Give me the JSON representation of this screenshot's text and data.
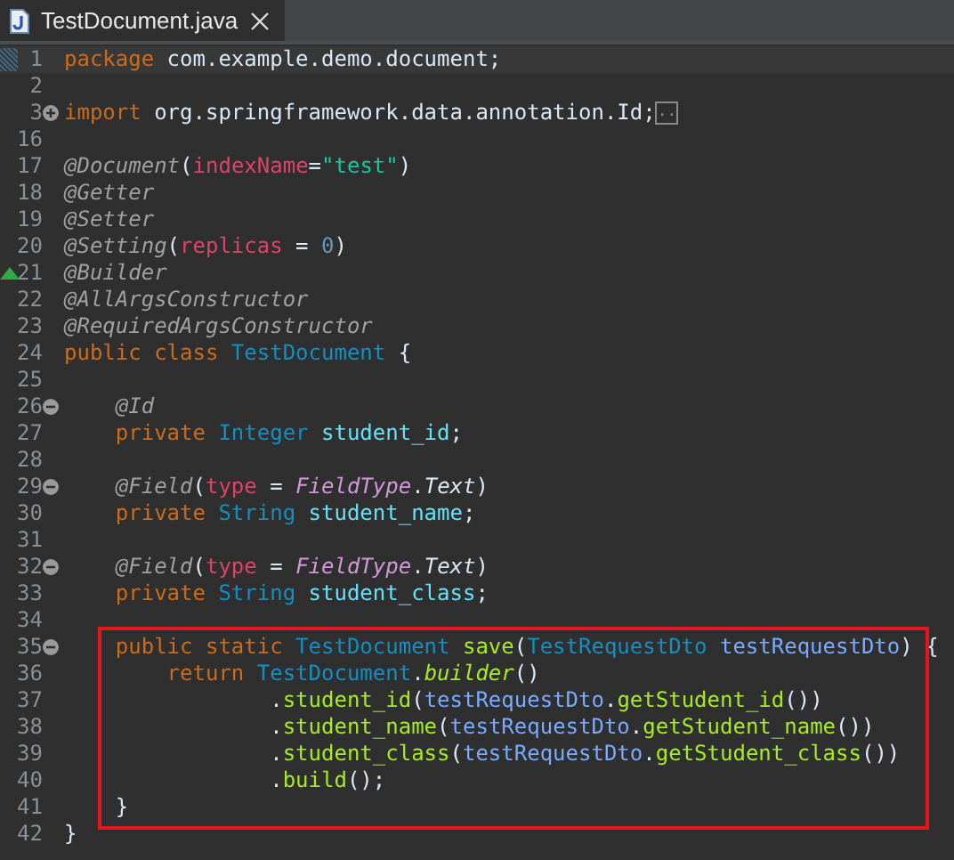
{
  "tabs": [
    {
      "title": "TestDocument.java",
      "selected": true
    }
  ],
  "lines": [
    {
      "kind": "line",
      "number": "1",
      "current": true,
      "tokens": [
        {
          "kind": "keyword",
          "text": "package"
        },
        {
          "kind": "plain",
          "text": " com.example.demo.document;"
        }
      ]
    },
    {
      "kind": "line",
      "number": "2",
      "current": false
    },
    {
      "kind": "line",
      "number": "3",
      "current": false,
      "expanded": false,
      "tokens": [
        {
          "kind": "keyword",
          "text": "import"
        },
        {
          "kind": "plain",
          "text": " org.springframework.data.annotation.Id;"
        },
        {
          "kind": "folded",
          "text": ".."
        }
      ]
    },
    {
      "kind": "line",
      "number": "16",
      "current": false
    },
    {
      "kind": "line",
      "number": "17",
      "current": false,
      "tokens": [
        {
          "kind": "annotation",
          "text": "@Document"
        },
        {
          "kind": "plain",
          "text": "("
        },
        {
          "kind": "attribute",
          "text": "indexName"
        },
        {
          "kind": "plain",
          "text": "="
        },
        {
          "kind": "string",
          "text": "\"test\""
        },
        {
          "kind": "plain",
          "text": ")"
        }
      ]
    },
    {
      "kind": "line",
      "number": "18",
      "current": false,
      "tokens": [
        {
          "kind": "annotation",
          "text": "@Getter"
        }
      ]
    },
    {
      "kind": "line",
      "number": "19",
      "current": false,
      "tokens": [
        {
          "kind": "annotation",
          "text": "@Setter"
        }
      ]
    },
    {
      "kind": "line",
      "number": "20",
      "current": false,
      "tokens": [
        {
          "kind": "annotation",
          "text": "@Setting"
        },
        {
          "kind": "plain",
          "text": "("
        },
        {
          "kind": "attribute",
          "text": "replicas"
        },
        {
          "kind": "plain",
          "text": " = "
        },
        {
          "kind": "number",
          "text": "0"
        },
        {
          "kind": "plain",
          "text": ")"
        }
      ]
    },
    {
      "kind": "line",
      "number": "21",
      "current": false,
      "overrides": true,
      "tokens": [
        {
          "kind": "annotation",
          "text": "@Builder"
        }
      ]
    },
    {
      "kind": "line",
      "number": "22",
      "current": false,
      "tokens": [
        {
          "kind": "annotation",
          "text": "@AllArgsConstructor"
        }
      ]
    },
    {
      "kind": "line",
      "number": "23",
      "current": false,
      "tokens": [
        {
          "kind": "annotation",
          "text": "@RequiredArgsConstructor"
        }
      ]
    },
    {
      "kind": "line",
      "number": "24",
      "current": false,
      "tokens": [
        {
          "kind": "keyword",
          "text": "public class "
        },
        {
          "kind": "type",
          "text": "TestDocument"
        },
        {
          "kind": "plain",
          "text": " {"
        }
      ]
    },
    {
      "kind": "line",
      "number": "25",
      "current": false
    },
    {
      "kind": "line",
      "number": "26",
      "current": false,
      "expanded": true,
      "tokens": [
        {
          "kind": "annotation",
          "text": "    @Id"
        }
      ]
    },
    {
      "kind": "line",
      "number": "27",
      "current": false,
      "tokens": [
        {
          "kind": "keyword",
          "text": "    private "
        },
        {
          "kind": "type",
          "text": "Integer "
        },
        {
          "kind": "field",
          "text": "student_id"
        },
        {
          "kind": "plain",
          "text": ";"
        }
      ]
    },
    {
      "kind": "line",
      "number": "28",
      "current": false
    },
    {
      "kind": "line",
      "number": "29",
      "current": false,
      "expanded": true,
      "tokens": [
        {
          "kind": "annotation",
          "text": "    @Field"
        },
        {
          "kind": "plain",
          "text": "("
        },
        {
          "kind": "attribute",
          "text": "type"
        },
        {
          "kind": "plain",
          "text": " = "
        },
        {
          "kind": "enum",
          "text": "FieldType"
        },
        {
          "kind": "plain",
          "text": "."
        },
        {
          "kind": "constant",
          "text": "Text"
        },
        {
          "kind": "plain",
          "text": ")"
        }
      ]
    },
    {
      "kind": "line",
      "number": "30",
      "current": false,
      "tokens": [
        {
          "kind": "keyword",
          "text": "    private "
        },
        {
          "kind": "type",
          "text": "String "
        },
        {
          "kind": "field",
          "text": "student_name"
        },
        {
          "kind": "plain",
          "text": ";"
        }
      ]
    },
    {
      "kind": "line",
      "number": "31",
      "current": false
    },
    {
      "kind": "line",
      "number": "32",
      "current": false,
      "expanded": true,
      "tokens": [
        {
          "kind": "annotation",
          "text": "    @Field"
        },
        {
          "kind": "plain",
          "text": "("
        },
        {
          "kind": "attribute",
          "text": "type"
        },
        {
          "kind": "plain",
          "text": " = "
        },
        {
          "kind": "enum",
          "text": "FieldType"
        },
        {
          "kind": "plain",
          "text": "."
        },
        {
          "kind": "constant",
          "text": "Text"
        },
        {
          "kind": "plain",
          "text": ")"
        }
      ]
    },
    {
      "kind": "line",
      "number": "33",
      "current": false,
      "tokens": [
        {
          "kind": "keyword",
          "text": "    private "
        },
        {
          "kind": "type",
          "text": "String "
        },
        {
          "kind": "field",
          "text": "student_class"
        },
        {
          "kind": "plain",
          "text": ";"
        }
      ]
    },
    {
      "kind": "line",
      "number": "34",
      "current": false
    },
    {
      "kind": "box",
      "lines": [
        {
          "kind": "line",
          "number": "35",
          "current": false,
          "expanded": true,
          "tokens": [
            {
              "kind": "keyword",
              "text": "    public static "
            },
            {
              "kind": "type",
              "text": "TestDocument "
            },
            {
              "kind": "method",
              "text": "save"
            },
            {
              "kind": "plain",
              "text": "("
            },
            {
              "kind": "type",
              "text": "TestRequestDto "
            },
            {
              "kind": "param",
              "text": "testRequestDto"
            },
            {
              "kind": "plain",
              "text": ") {"
            }
          ]
        },
        {
          "kind": "line",
          "number": "36",
          "current": false,
          "tokens": [
            {
              "kind": "keyword",
              "text": "        return "
            },
            {
              "kind": "type",
              "text": "TestDocument"
            },
            {
              "kind": "plain",
              "text": "."
            },
            {
              "kind": "static-method",
              "text": "builder"
            },
            {
              "kind": "plain",
              "text": "()"
            }
          ]
        },
        {
          "kind": "line",
          "number": "37",
          "current": false,
          "tokens": [
            {
              "kind": "plain",
              "text": "                ."
            },
            {
              "kind": "method",
              "text": "student_id"
            },
            {
              "kind": "plain",
              "text": "("
            },
            {
              "kind": "param",
              "text": "testRequestDto"
            },
            {
              "kind": "plain",
              "text": "."
            },
            {
              "kind": "method",
              "text": "getStudent_id"
            },
            {
              "kind": "plain",
              "text": "())"
            }
          ]
        },
        {
          "kind": "line",
          "number": "38",
          "current": false,
          "tokens": [
            {
              "kind": "plain",
              "text": "                ."
            },
            {
              "kind": "method",
              "text": "student_name"
            },
            {
              "kind": "plain",
              "text": "("
            },
            {
              "kind": "param",
              "text": "testRequestDto"
            },
            {
              "kind": "plain",
              "text": "."
            },
            {
              "kind": "method",
              "text": "getStudent_name"
            },
            {
              "kind": "plain",
              "text": "())"
            }
          ]
        },
        {
          "kind": "line",
          "number": "39",
          "current": false,
          "tokens": [
            {
              "kind": "plain",
              "text": "                ."
            },
            {
              "kind": "method",
              "text": "student_class"
            },
            {
              "kind": "plain",
              "text": "("
            },
            {
              "kind": "param",
              "text": "testRequestDto"
            },
            {
              "kind": "plain",
              "text": "."
            },
            {
              "kind": "method",
              "text": "getStudent_class"
            },
            {
              "kind": "plain",
              "text": "())"
            }
          ]
        },
        {
          "kind": "line",
          "number": "40",
          "current": false,
          "tokens": [
            {
              "kind": "plain",
              "text": "                ."
            },
            {
              "kind": "method",
              "text": "build"
            },
            {
              "kind": "plain",
              "text": "();"
            }
          ]
        },
        {
          "kind": "line",
          "number": "41",
          "current": false,
          "tokens": [
            {
              "kind": "plain",
              "text": "    }"
            }
          ]
        }
      ]
    },
    {
      "kind": "line",
      "number": "42",
      "current": false,
      "tokens": [
        {
          "kind": "plain",
          "text": "}"
        }
      ]
    }
  ]
}
